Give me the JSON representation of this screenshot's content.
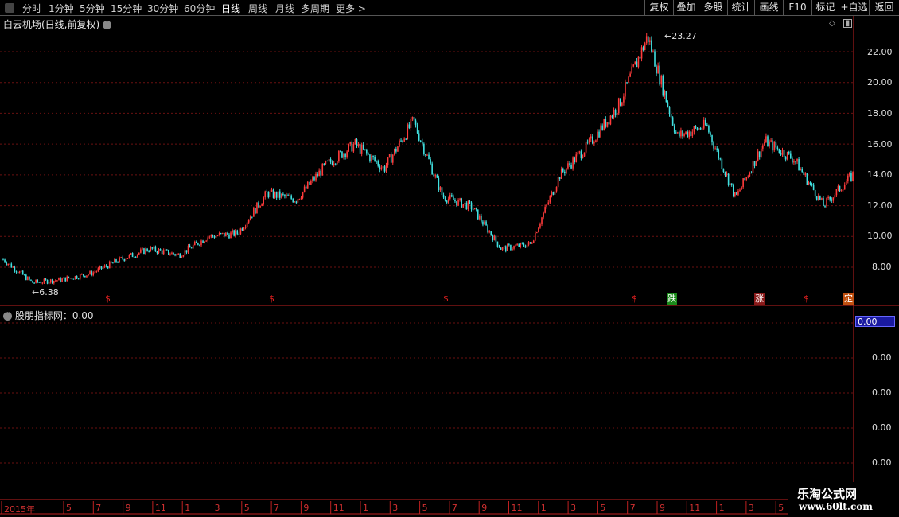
{
  "toolbar": {
    "tabs": [
      "分时",
      "1分钟",
      "5分钟",
      "15分钟",
      "30分钟",
      "60分钟",
      "日线",
      "周线",
      "月线",
      "多周期",
      "更多 >"
    ],
    "active": "日线",
    "right_buttons": [
      "复权",
      "叠加",
      "多股",
      "统计",
      "画线",
      "F10",
      "标记",
      "+自选",
      "返回"
    ]
  },
  "main": {
    "title": "白云机场(日线,前复权)",
    "y_ticks": [
      "22.00",
      "20.00",
      "18.00",
      "16.00",
      "14.00",
      "12.00",
      "10.00",
      "8.00"
    ],
    "high_label": "23.27",
    "low_label": "6.38"
  },
  "signals": [
    {
      "text": "$",
      "color": "#e02020",
      "bg": "transparent"
    },
    {
      "text": "$",
      "color": "#e02020",
      "bg": "transparent"
    },
    {
      "text": "$",
      "color": "#e02020",
      "bg": "transparent"
    },
    {
      "text": "$",
      "color": "#e02020",
      "bg": "transparent"
    },
    {
      "text": "跌",
      "color": "#ffffff",
      "bg": "#1a8a1a"
    },
    {
      "text": "涨",
      "color": "#ffffff",
      "bg": "#8a1a1a"
    },
    {
      "text": "$",
      "color": "#e02020",
      "bg": "transparent"
    },
    {
      "text": "定",
      "color": "#ffffff",
      "bg": "#c05010"
    }
  ],
  "indicator": {
    "title": "股朋指标网：0.00",
    "value_box": "0.00",
    "y_ticks": [
      "0.00",
      "0.00",
      "0.00",
      "0.00"
    ]
  },
  "x_axis": {
    "labels": [
      "2015年",
      "5",
      "7",
      "9",
      "11",
      "1",
      "3",
      "5",
      "7",
      "9",
      "11",
      "1",
      "3",
      "5",
      "7",
      "9",
      "11",
      "1",
      "3",
      "5",
      "7",
      "9",
      "11",
      "1",
      "3",
      "5"
    ]
  },
  "brand": {
    "line1": "乐淘公式网",
    "line2": "www.60lt.com"
  },
  "colors": {
    "up": "#ff3b3b",
    "down": "#40e0e0",
    "grid": "#7a1a1a",
    "axis": "#c02020"
  },
  "chart_data": {
    "type": "candlestick",
    "title": "白云机场(日线,前复权)",
    "y_range": [
      6.0,
      23.5
    ],
    "x": [
      "2015-01",
      "2015-03",
      "2015-05",
      "2015-07",
      "2015-09",
      "2015-11",
      "2016-01",
      "2016-03",
      "2016-05",
      "2016-07",
      "2016-09",
      "2016-11",
      "2017-01",
      "2017-03",
      "2017-05",
      "2017-07",
      "2017-09",
      "2017-11",
      "2018-01",
      "2018-03",
      "2018-05",
      "2018-07",
      "2018-09",
      "2018-11",
      "2019-01",
      "2019-03",
      "2019-05"
    ],
    "close": [
      8.5,
      7.0,
      7.2,
      7.6,
      8.5,
      9.2,
      8.8,
      10.0,
      10.2,
      12.8,
      12.4,
      14.6,
      16.0,
      14.4,
      17.5,
      12.6,
      11.9,
      9.2,
      9.5,
      14.0,
      16.0,
      18.5,
      23.0,
      16.5,
      17.2,
      12.5,
      16.2,
      15.0,
      12.0,
      14.0
    ],
    "max": 23.27,
    "min": 6.38
  }
}
